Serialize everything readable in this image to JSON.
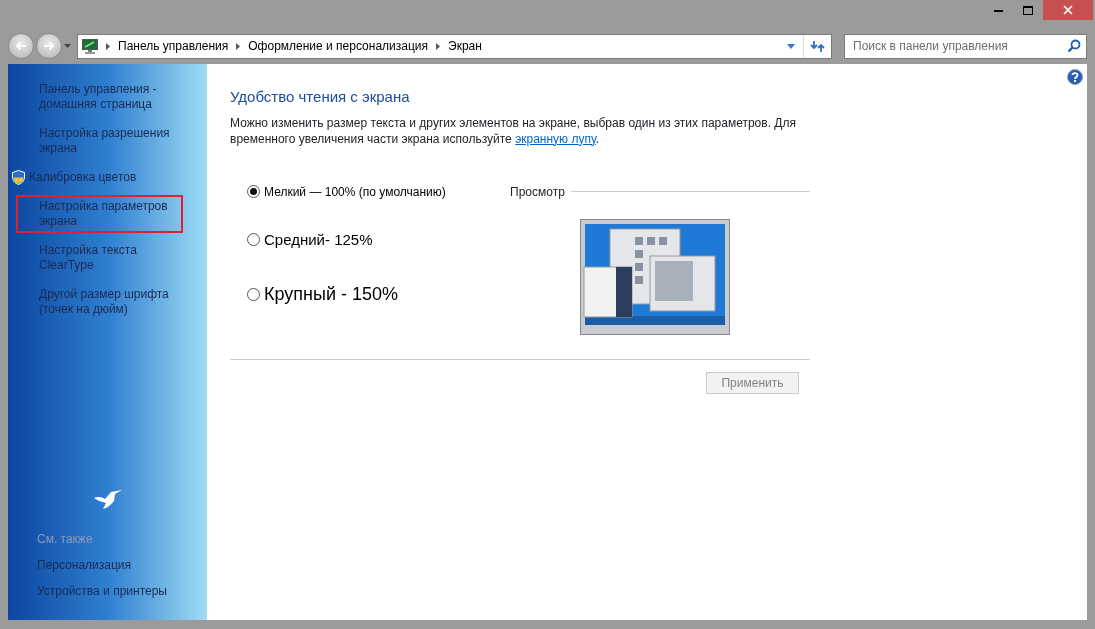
{
  "window_buttons": [
    {
      "kind": "minimize"
    },
    {
      "kind": "maximize"
    },
    {
      "kind": "close"
    }
  ],
  "address_bar": {
    "breadcrumbs": [
      "Панель управления",
      "Оформление и персонализация",
      "Экран"
    ]
  },
  "search": {
    "placeholder": "Поиск в панели управления"
  },
  "sidebar": {
    "items": [
      {
        "label": "Панель управления - домашняя страница",
        "kind": "link",
        "highlighted": false
      },
      {
        "label": "Настройка разрешения экрана",
        "kind": "link",
        "highlighted": false
      },
      {
        "label": "Калибровка цветов",
        "kind": "shield",
        "highlighted": false
      },
      {
        "label": "Настройка параметров экрана",
        "kind": "link",
        "highlighted": true
      },
      {
        "label": "Настройка текста ClearType",
        "kind": "link",
        "highlighted": false
      },
      {
        "label": "Другой размер шрифта (точек на дюйм)",
        "kind": "link",
        "highlighted": false
      }
    ],
    "see_also": {
      "heading": "См. также",
      "items": [
        "Персонализация",
        "Устройства и принтеры"
      ]
    }
  },
  "content": {
    "title": "Удобство чтения с экрана",
    "description_before": "Можно изменить размер текста и других элементов на экране, выбрав один из этих параметров. Для временного увеличения части экрана используйте ",
    "link": "экранную лупу",
    "description_after": ".",
    "options": [
      {
        "label": "Мелкий — 100% (по умолчанию)",
        "selected": true
      },
      {
        "label": "Средний- 125%",
        "selected": false
      },
      {
        "label": "Крупный - 150%",
        "selected": false
      }
    ],
    "preview_label": "Просмотр",
    "apply_button": {
      "label": "Применить",
      "disabled": true
    }
  }
}
